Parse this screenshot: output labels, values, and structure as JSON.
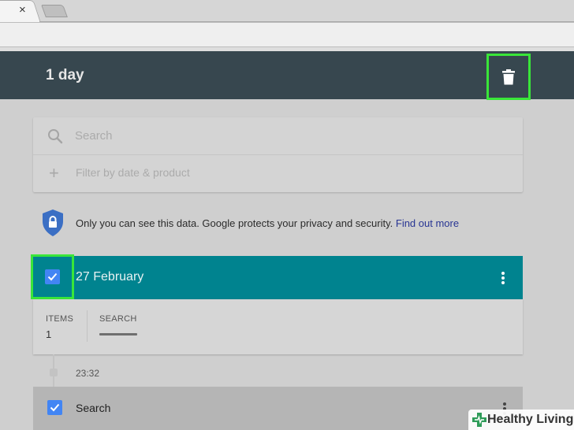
{
  "browser": {
    "tab_close_glyph": "×"
  },
  "header": {
    "title": "1 day"
  },
  "search": {
    "placeholder": "Search",
    "filter_label": "Filter by date & product"
  },
  "privacy": {
    "text": "Only you can see this data. Google protects your privacy and security.",
    "link": "Find out more"
  },
  "day_card": {
    "title": "27 February",
    "checked": true,
    "summary": {
      "items_label": "ITEMS",
      "items_value": "1",
      "search_label": "SEARCH"
    }
  },
  "entry": {
    "time": "23:32",
    "label": "Search",
    "checked": true
  },
  "watermark": {
    "text": "Healthy Living"
  },
  "colors": {
    "header_bg": "#37474f",
    "day_header_bg": "#00838f",
    "checkbox": "#4285f4",
    "highlight": "#39e639",
    "link": "#283593",
    "watermark_cross": "#2e9b58"
  },
  "icons": {
    "delete": "trash-icon",
    "search": "search-icon",
    "filter": "plus-icon",
    "privacy": "shield-lock-icon",
    "more": "more-vert-icon",
    "check": "check-icon"
  }
}
